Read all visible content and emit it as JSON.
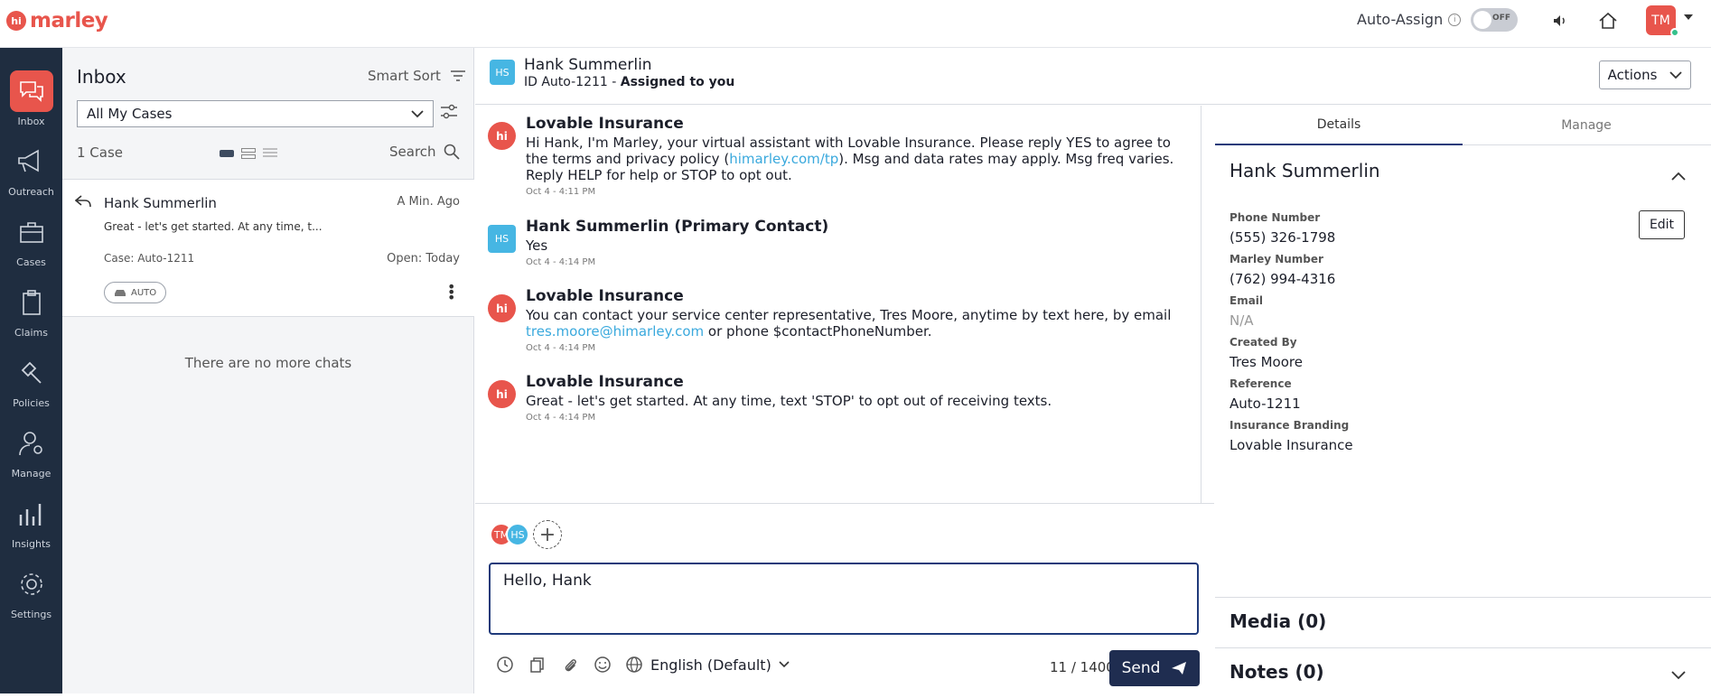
{
  "app": {
    "logo_text": "marley",
    "logo_mark": "hi"
  },
  "topbar": {
    "auto_assign_label": "Auto-Assign",
    "toggle_state": "OFF",
    "user_initials": "TM"
  },
  "nav": {
    "items": [
      {
        "label": "Inbox",
        "icon": "chat-bubbles-icon",
        "active": true
      },
      {
        "label": "Outreach",
        "icon": "megaphone-icon",
        "active": false
      },
      {
        "label": "Cases",
        "icon": "briefcase-icon",
        "active": false
      },
      {
        "label": "Claims",
        "icon": "clipboard-icon",
        "active": false
      },
      {
        "label": "Policies",
        "icon": "gavel-icon",
        "active": false
      },
      {
        "label": "Manage",
        "icon": "user-gear-icon",
        "active": false
      },
      {
        "label": "Insights",
        "icon": "bar-chart-icon",
        "active": false
      },
      {
        "label": "Settings",
        "icon": "gear-icon",
        "active": false
      }
    ]
  },
  "inbox": {
    "title": "Inbox",
    "smart_sort": "Smart Sort",
    "filter_selected": "All My Cases",
    "case_count": "1 Case",
    "search_label": "Search",
    "no_more": "There are no more chats",
    "case": {
      "name": "Hank Summerlin",
      "time": "A Min. Ago",
      "preview": "Great - let's get started. At any time, t...",
      "case_id": "Case: Auto-1211",
      "open": "Open: Today",
      "tag": "AUTO"
    }
  },
  "conversation": {
    "initials": "HS",
    "name": "Hank Summerlin",
    "id_text": "ID Auto-1211 -",
    "assigned": "Assigned to you",
    "actions_label": "Actions",
    "messages": [
      {
        "sender": "Lovable Insurance",
        "avatar": "hi",
        "text_a": "Hi Hank, I'm Marley, your virtual assistant with Lovable Insurance. Please reply YES to agree to the terms and privacy policy (",
        "link": "himarley.com/tp",
        "text_b": "). Msg and data rates may apply. Msg freq varies. Reply HELP for help or STOP to opt out.",
        "time": "Oct 4 - 4:11 PM"
      },
      {
        "sender": "Hank Summerlin (Primary Contact)",
        "avatar": "HS",
        "text_a": "Yes",
        "link": "",
        "text_b": "",
        "time": "Oct 4 - 4:14 PM"
      },
      {
        "sender": "Lovable Insurance",
        "avatar": "hi",
        "text_a": "You can contact your service center representative, Tres Moore, anytime by text here, by email ",
        "link": "tres.moore@himarley.com",
        "text_b": " or phone $contactPhoneNumber.",
        "time": "Oct 4 - 4:14 PM"
      },
      {
        "sender": "Lovable Insurance",
        "avatar": "hi",
        "text_a": "Great - let's get started. At any time, text 'STOP' to opt out of receiving texts.",
        "link": "",
        "text_b": "",
        "time": "Oct 4 - 4:14 PM"
      }
    ]
  },
  "compose": {
    "participants": [
      {
        "initials": "TM",
        "color": "#e8554c"
      },
      {
        "initials": "HS",
        "color": "#46b6e3"
      }
    ],
    "value": "Hello, Hank",
    "language": "English (Default)",
    "char_count": "11 / 1400",
    "send_label": "Send"
  },
  "details": {
    "tab_details": "Details",
    "tab_manage": "Manage",
    "name": "Hank Summerlin",
    "edit_label": "Edit",
    "fields": [
      {
        "label": "Phone Number",
        "value": "(555) 326-1798"
      },
      {
        "label": "Marley Number",
        "value": "(762) 994-4316"
      },
      {
        "label": "Email",
        "value": "N/A"
      },
      {
        "label": "Created By",
        "value": "Tres Moore"
      },
      {
        "label": "Reference",
        "value": "Auto-1211"
      },
      {
        "label": "Insurance Branding",
        "value": "Lovable Insurance"
      }
    ],
    "media": "Media (0)",
    "notes": "Notes (0)"
  }
}
